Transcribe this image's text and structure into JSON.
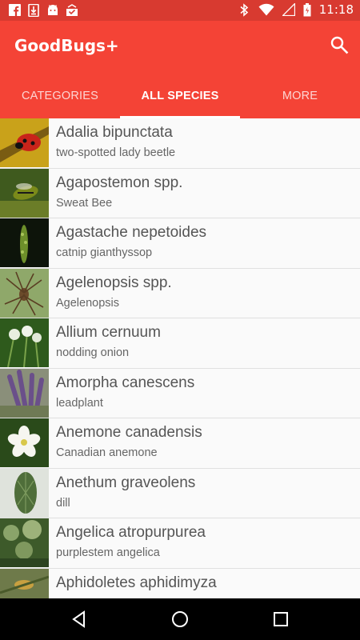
{
  "status_bar": {
    "time": "11:18",
    "icons": [
      "facebook-icon",
      "download-icon",
      "android-icon",
      "inbox-icon",
      "bluetooth-icon",
      "wifi-icon",
      "signal-icon",
      "battery-icon"
    ]
  },
  "app_bar": {
    "title": "GoodBugs+",
    "search_icon": "search-icon",
    "color": "#f44336",
    "status_color": "#d83a30"
  },
  "tabs": [
    {
      "label": "CATEGORIES",
      "active": false
    },
    {
      "label": "ALL SPECIES",
      "active": true
    },
    {
      "label": "MORE",
      "active": false
    }
  ],
  "species": [
    {
      "scientific": "Adalia bipunctata",
      "common": "two-spotted lady beetle"
    },
    {
      "scientific": "Agapostemon spp.",
      "common": "Sweat Bee"
    },
    {
      "scientific": "Agastache nepetoides",
      "common": "catnip gianthyssop"
    },
    {
      "scientific": "Agelenopsis spp.",
      "common": "Agelenopsis"
    },
    {
      "scientific": "Allium cernuum",
      "common": "nodding onion"
    },
    {
      "scientific": "Amorpha canescens",
      "common": "leadplant"
    },
    {
      "scientific": "Anemone canadensis",
      "common": "Canadian anemone"
    },
    {
      "scientific": "Anethum graveolens",
      "common": "dill"
    },
    {
      "scientific": "Angelica atropurpurea",
      "common": "purplestem angelica"
    },
    {
      "scientific": "Aphidoletes aphidimyza",
      "common": ""
    }
  ],
  "nav_bar": {
    "back_icon": "back-icon",
    "home_icon": "home-icon",
    "recents_icon": "recents-icon"
  }
}
